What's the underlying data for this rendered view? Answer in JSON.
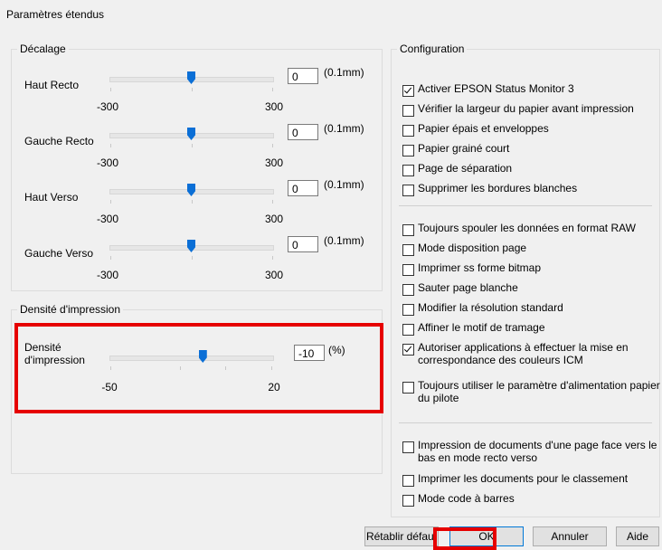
{
  "window": {
    "title": "Paramètres étendus"
  },
  "decalage": {
    "legend": "Décalage",
    "sliders": [
      {
        "label": "Haut Recto",
        "value": "0",
        "unit": "(0.1mm)",
        "min_label": "-300",
        "max_label": "300",
        "level": 0.5
      },
      {
        "label": "Gauche Recto",
        "value": "0",
        "unit": "(0.1mm)",
        "min_label": "-300",
        "max_label": "300",
        "level": 0.5
      },
      {
        "label": "Haut Verso",
        "value": "0",
        "unit": "(0.1mm)",
        "min_label": "-300",
        "max_label": "300",
        "level": 0.5
      },
      {
        "label": "Gauche Verso",
        "value": "0",
        "unit": "(0.1mm)",
        "min_label": "-300",
        "max_label": "300",
        "level": 0.5
      }
    ]
  },
  "densite": {
    "legend": "Densité d'impression",
    "label": "Densité d'impression",
    "value": "-10",
    "unit": "(%)",
    "min_label": "-50",
    "max_label": "20",
    "level": 0.571
  },
  "configuration": {
    "legend": "Configuration",
    "group1": [
      {
        "label": "Activer EPSON Status Monitor 3",
        "checked": true
      },
      {
        "label": "Vérifier la largeur du papier avant impression",
        "checked": false
      },
      {
        "label": "Papier épais et enveloppes",
        "checked": false
      },
      {
        "label": "Papier grainé court",
        "checked": false
      },
      {
        "label": "Page de séparation",
        "checked": false
      },
      {
        "label": "Supprimer les bordures blanches",
        "checked": false
      }
    ],
    "group2": [
      {
        "label": "Toujours spouler les données en format RAW",
        "checked": false
      },
      {
        "label": "Mode disposition page",
        "checked": false
      },
      {
        "label": "Imprimer ss forme bitmap",
        "checked": false
      },
      {
        "label": "Sauter page blanche",
        "checked": false
      },
      {
        "label": "Modifier la résolution standard",
        "checked": false
      },
      {
        "label": "Affiner le motif de tramage",
        "checked": false
      },
      {
        "label": "Autoriser applications à effectuer la mise en correspondance des couleurs ICM",
        "checked": true
      },
      {
        "label": "Toujours utiliser le paramètre d'alimentation papier du pilote",
        "checked": false
      }
    ],
    "group3": [
      {
        "label": "Impression de documents d'une page face vers le bas en mode recto verso",
        "checked": false
      },
      {
        "label": "Imprimer les documents pour le classement",
        "checked": false
      },
      {
        "label": "Mode code à barres",
        "checked": false
      }
    ]
  },
  "buttons": {
    "reset": "Rétablir défaut",
    "ok": "OK",
    "cancel": "Annuler",
    "help": "Aide"
  },
  "colors": {
    "accent": "#0b6fd6",
    "highlight": "#e60000"
  }
}
